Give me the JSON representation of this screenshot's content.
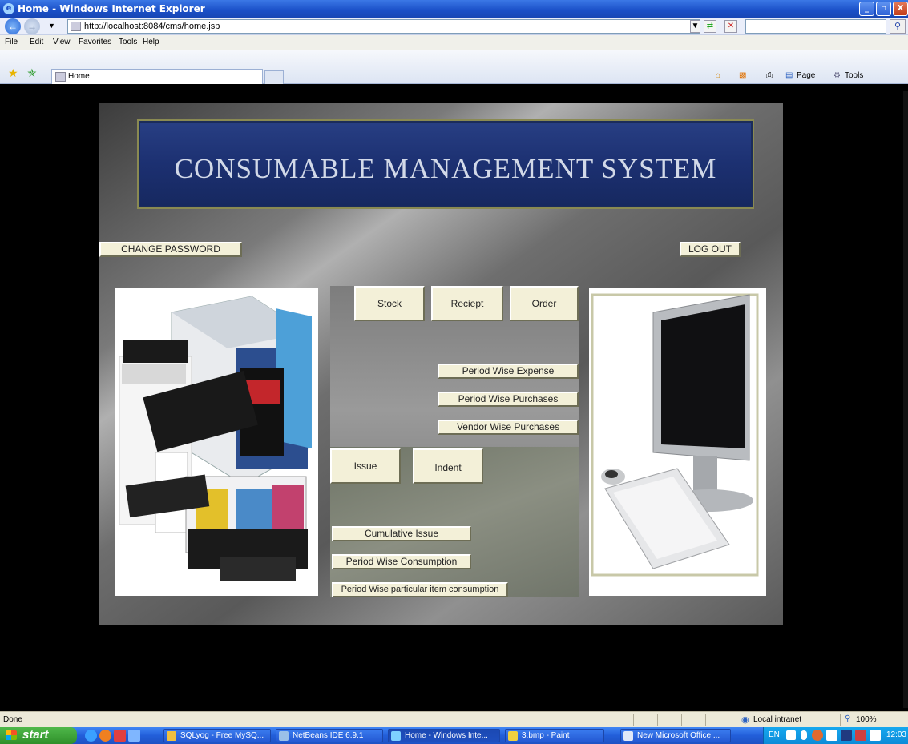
{
  "window": {
    "title": "Home - Windows Internet Explorer",
    "minimize": "_",
    "maximize": "▫",
    "close": "X"
  },
  "address": {
    "url": "http://localhost:8084/cms/home.jsp"
  },
  "menu": [
    "File",
    "Edit",
    "View",
    "Favorites",
    "Tools",
    "Help"
  ],
  "tab": {
    "label": "Home"
  },
  "toolbar": {
    "page": "Page",
    "tools": "Tools"
  },
  "page": {
    "banner_title": "CONSUMABLE MANAGEMENT SYSTEM",
    "change_password": "CHANGE PASSWORD",
    "logout": "LOG OUT",
    "stock": "Stock",
    "receipt": "Reciept",
    "order": "Order",
    "period_wise_expense": "Period Wise Expense",
    "period_wise_purchases": "Period Wise Purchases",
    "vendor_wise_purchases": "Vendor Wise Purchases",
    "issue": "Issue",
    "indent": "Indent",
    "cumulative_issue": "Cumulative Issue",
    "period_wise_consumption": "Period Wise Consumption",
    "period_wise_particular": "Period Wise particular item consumption"
  },
  "status": {
    "text": "Done",
    "zone": "Local intranet",
    "zoom": "100%"
  },
  "taskbar": {
    "start": "start",
    "tasks": [
      "SQLyog - Free MySQ...",
      "NetBeans IDE 6.9.1",
      "Home - Windows Inte...",
      "3.bmp - Paint",
      "New Microsoft Office ..."
    ],
    "lang": "EN",
    "clock": "12:03"
  },
  "colors": {
    "banner_bg": "#1c3071",
    "button_bg": "#f3f0d8",
    "panel_bg": "#7a7a7a"
  }
}
